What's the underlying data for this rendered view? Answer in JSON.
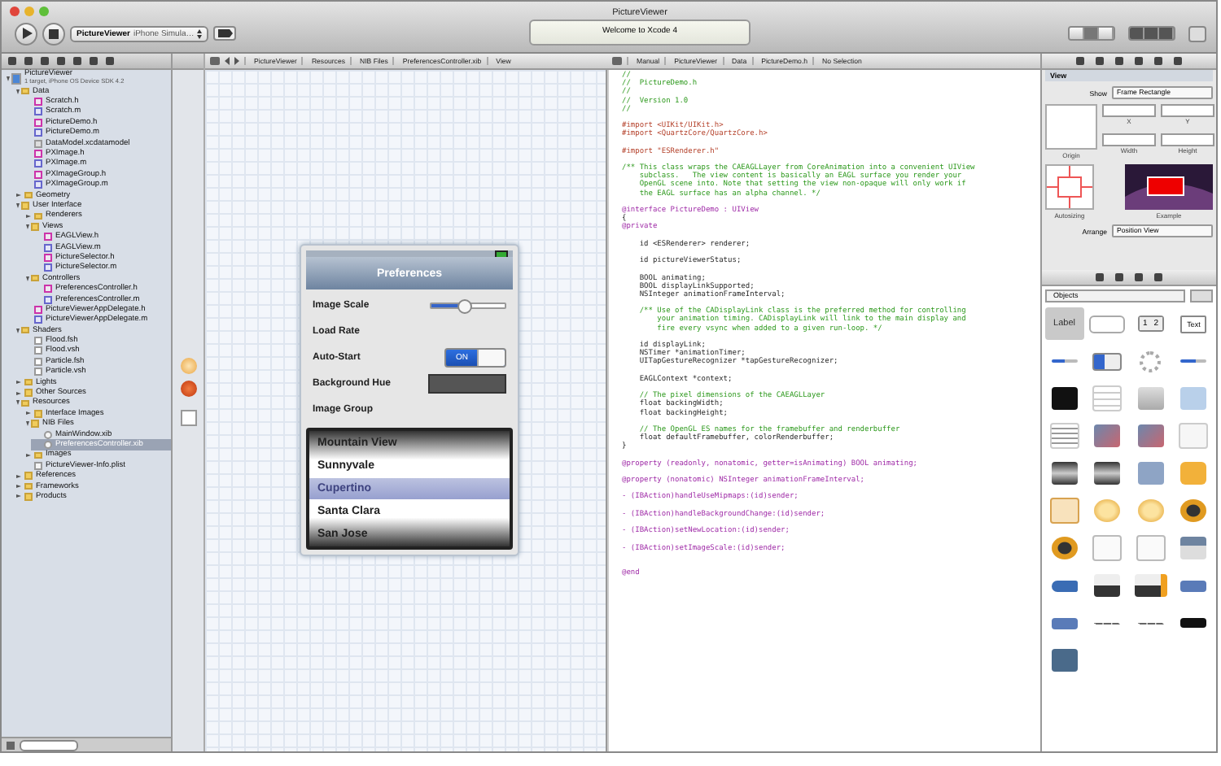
{
  "window": {
    "title": "PictureViewer"
  },
  "toolbar": {
    "scheme": "PictureViewer",
    "destination": "iPhone Simula…",
    "activity": "Welcome to Xcode 4"
  },
  "ib_jump_bar": [
    "PictureViewer",
    "Resources",
    "NIB Files",
    "PreferencesController.xib",
    "View"
  ],
  "editor_jump_bar": [
    "Manual",
    "PictureViewer",
    "Data",
    "PictureDemo.h",
    "No Selection"
  ],
  "navigator": {
    "tree": [
      {
        "name": "PictureViewer",
        "subtitle": "1 target, iPhone OS Device SDK 4.2",
        "kind": "project",
        "expanded": true,
        "selected": false,
        "children": [
          {
            "name": "Data",
            "kind": "folder",
            "expanded": true,
            "selected": false,
            "children": [
              {
                "name": "Scratch.h",
                "kind": "header",
                "selected": false
              },
              {
                "name": "Scratch.m",
                "kind": "source",
                "selected": false
              },
              {
                "name": "PictureDemo.h",
                "kind": "header",
                "selected": false
              },
              {
                "name": "PictureDemo.m",
                "kind": "source",
                "selected": false
              },
              {
                "name": "DataModel.xcdatamodel",
                "kind": "model",
                "selected": false
              },
              {
                "name": "PXImage.h",
                "kind": "header",
                "selected": false
              },
              {
                "name": "PXImage.m",
                "kind": "source",
                "selected": false
              },
              {
                "name": "PXImageGroup.h",
                "kind": "header",
                "selected": false
              },
              {
                "name": "PXImageGroup.m",
                "kind": "source",
                "selected": false
              }
            ]
          },
          {
            "name": "Geometry",
            "kind": "folder",
            "expanded": false,
            "selected": false
          },
          {
            "name": "User Interface",
            "kind": "folder",
            "expanded": true,
            "selected": false,
            "children": [
              {
                "name": "Renderers",
                "kind": "folder",
                "expanded": false,
                "selected": false
              },
              {
                "name": "Views",
                "kind": "folder",
                "expanded": true,
                "selected": false,
                "children": [
                  {
                    "name": "EAGLView.h",
                    "kind": "header",
                    "selected": false
                  },
                  {
                    "name": "EAGLView.m",
                    "kind": "source",
                    "selected": false
                  },
                  {
                    "name": "PictureSelector.h",
                    "kind": "header",
                    "selected": false
                  },
                  {
                    "name": "PictureSelector.m",
                    "kind": "source",
                    "selected": false
                  }
                ]
              },
              {
                "name": "Controllers",
                "kind": "folder",
                "expanded": true,
                "selected": false,
                "children": [
                  {
                    "name": "PreferencesController.h",
                    "kind": "header",
                    "selected": false
                  },
                  {
                    "name": "PreferencesController.m",
                    "kind": "source",
                    "selected": false
                  }
                ]
              },
              {
                "name": "PictureViewerAppDelegate.h",
                "kind": "header",
                "selected": false
              },
              {
                "name": "PictureViewerAppDelegate.m",
                "kind": "source",
                "selected": false
              }
            ]
          },
          {
            "name": "Shaders",
            "kind": "folder",
            "expanded": true,
            "selected": false,
            "children": [
              {
                "name": "Flood.fsh",
                "kind": "shader",
                "selected": false
              },
              {
                "name": "Flood.vsh",
                "kind": "shader",
                "selected": false
              },
              {
                "name": "Particle.fsh",
                "kind": "shader",
                "selected": false
              },
              {
                "name": "Particle.vsh",
                "kind": "shader",
                "selected": false
              }
            ]
          },
          {
            "name": "Lights",
            "kind": "folder",
            "expanded": false,
            "selected": false
          },
          {
            "name": "Other Sources",
            "kind": "folder",
            "expanded": false,
            "selected": false
          },
          {
            "name": "Resources",
            "kind": "folder",
            "expanded": true,
            "selected": false,
            "children": [
              {
                "name": "Interface Images",
                "kind": "folder",
                "expanded": false,
                "selected": false
              },
              {
                "name": "NIB Files",
                "kind": "folder",
                "expanded": true,
                "selected": false,
                "children": [
                  {
                    "name": "MainWindow.xib",
                    "kind": "xib",
                    "selected": false
                  },
                  {
                    "name": "PreferencesController.xib",
                    "kind": "xib",
                    "selected": true
                  }
                ]
              },
              {
                "name": "Images",
                "kind": "images",
                "expanded": false,
                "selected": false
              },
              {
                "name": "PictureViewer-Info.plist",
                "kind": "plist",
                "selected": false
              }
            ]
          },
          {
            "name": "References",
            "kind": "folder",
            "expanded": false,
            "selected": false
          },
          {
            "name": "Frameworks",
            "kind": "folder",
            "expanded": false,
            "selected": false
          },
          {
            "name": "Products",
            "kind": "folder",
            "expanded": false,
            "selected": false
          }
        ]
      }
    ]
  },
  "preferences": {
    "title": "Preferences",
    "rows": [
      {
        "kind": "slider",
        "label": "Image Scale",
        "level": 0.45
      },
      {
        "kind": "plain",
        "label": "Load Rate"
      },
      {
        "kind": "switch",
        "label": "Auto-Start",
        "on": true,
        "switch_text": "ON"
      },
      {
        "kind": "swatch",
        "label": "Background Hue"
      },
      {
        "kind": "plain",
        "label": "Image Group"
      }
    ],
    "picker": [
      {
        "text": "Mountain View",
        "selected": false
      },
      {
        "text": "Sunnyvale",
        "selected": false
      },
      {
        "text": "Cupertino",
        "selected": true
      },
      {
        "text": "Santa Clara",
        "selected": false
      },
      {
        "text": "San Jose",
        "selected": false
      }
    ]
  },
  "code": [
    {
      "kind": "comment",
      "text": "//"
    },
    {
      "kind": "comment",
      "text": "//  PictureDemo.h"
    },
    {
      "kind": "comment",
      "text": "//"
    },
    {
      "kind": "comment",
      "text": "//  Version 1.0"
    },
    {
      "kind": "comment",
      "text": "//"
    },
    {
      "kind": "blank"
    },
    {
      "kind": "directive",
      "text": "#import <UIKit/UIKit.h>"
    },
    {
      "kind": "directive",
      "text": "#import <QuartzCore/QuartzCore.h>"
    },
    {
      "kind": "blank"
    },
    {
      "kind": "directive",
      "text": "#import \"ESRenderer.h\""
    },
    {
      "kind": "blank"
    },
    {
      "kind": "comment",
      "text": "/** This class wraps the CAEAGLLayer from CoreAnimation into a convenient UIView"
    },
    {
      "kind": "comment",
      "text": "    subclass.   The view content is basically an EAGL surface you render your"
    },
    {
      "kind": "comment",
      "text": "    OpenGL scene into. Note that setting the view non-opaque will only work if"
    },
    {
      "kind": "comment",
      "text": "    the EAGL surface has an alpha channel. */"
    },
    {
      "kind": "blank"
    },
    {
      "kind": "keyword",
      "text": "@interface PictureDemo : UIView"
    },
    {
      "kind": "code",
      "text": "{"
    },
    {
      "kind": "keyword",
      "text": "@private"
    },
    {
      "kind": "blank"
    },
    {
      "kind": "code",
      "text": "    id <ESRenderer> renderer;"
    },
    {
      "kind": "blank"
    },
    {
      "kind": "code",
      "text": "    id pictureViewerStatus;"
    },
    {
      "kind": "blank"
    },
    {
      "kind": "code",
      "text": "    BOOL animating;"
    },
    {
      "kind": "code",
      "text": "    BOOL displayLinkSupported;"
    },
    {
      "kind": "code",
      "text": "    NSInteger animationFrameInterval;"
    },
    {
      "kind": "blank"
    },
    {
      "kind": "comment",
      "text": "    /** Use of the CADisplayLink class is the preferred method for controlling"
    },
    {
      "kind": "comment",
      "text": "        your animation timing. CADisplayLink will link to the main display and"
    },
    {
      "kind": "comment",
      "text": "        fire every vsync when added to a given run-loop. */"
    },
    {
      "kind": "blank"
    },
    {
      "kind": "code",
      "text": "    id displayLink;"
    },
    {
      "kind": "code",
      "text": "    NSTimer *animationTimer;"
    },
    {
      "kind": "code",
      "text": "    UITapGestureRecognizer *tapGestureRecognizer;"
    },
    {
      "kind": "blank"
    },
    {
      "kind": "code",
      "text": "    EAGLContext *context;"
    },
    {
      "kind": "blank"
    },
    {
      "kind": "comment",
      "text": "    // The pixel dimensions of the CAEAGLLayer"
    },
    {
      "kind": "code",
      "text": "    float backingWidth;"
    },
    {
      "kind": "code",
      "text": "    float backingHeight;"
    },
    {
      "kind": "blank"
    },
    {
      "kind": "comment",
      "text": "    // The OpenGL ES names for the framebuffer and renderbuffer"
    },
    {
      "kind": "code",
      "text": "    float defaultFramebuffer, colorRenderbuffer;"
    },
    {
      "kind": "code",
      "text": "}"
    },
    {
      "kind": "blank"
    },
    {
      "kind": "keyword",
      "text": "@property (readonly, nonatomic, getter=isAnimating) BOOL animating;"
    },
    {
      "kind": "blank"
    },
    {
      "kind": "keyword",
      "text": "@property (nonatomic) NSInteger animationFrameInterval;"
    },
    {
      "kind": "blank"
    },
    {
      "kind": "keyword",
      "text": "- (IBAction)handleUseMipmaps:(id)sender;"
    },
    {
      "kind": "blank"
    },
    {
      "kind": "keyword",
      "text": "- (IBAction)handleBackgroundChange:(id)sender;"
    },
    {
      "kind": "blank"
    },
    {
      "kind": "keyword",
      "text": "- (IBAction)setNewLocation:(id)sender;"
    },
    {
      "kind": "blank"
    },
    {
      "kind": "keyword",
      "text": "- (IBAction)setImageScale:(id)sender;"
    },
    {
      "kind": "blank"
    },
    {
      "kind": "blank"
    },
    {
      "kind": "keyword",
      "text": "@end"
    }
  ],
  "inspector": {
    "section": "View",
    "show_label": "Show",
    "show_value": "Frame Rectangle",
    "fields": [
      "X",
      "Y",
      "Width",
      "Height"
    ],
    "origin_label": "Origin",
    "autosizing_label": "Autosizing",
    "example_label": "Example",
    "arrange_label": "Arrange",
    "arrange_value": "Position View"
  },
  "library": {
    "popup": "Objects",
    "items": [
      {
        "kind": "label",
        "text": "Label",
        "selected": true
      },
      {
        "kind": "button",
        "selected": false
      },
      {
        "kind": "segmented",
        "segments": [
          "1",
          "2"
        ],
        "selected": false
      },
      {
        "kind": "textfield",
        "text": "Text",
        "selected": false
      },
      {
        "kind": "slider",
        "selected": false
      },
      {
        "kind": "switch",
        "selected": false
      },
      {
        "kind": "activity",
        "selected": false
      },
      {
        "kind": "progress",
        "selected": false
      },
      {
        "kind": "dark",
        "selected": false
      },
      {
        "kind": "table",
        "selected": false
      },
      {
        "kind": "bar",
        "selected": false
      },
      {
        "kind": "map",
        "selected": false
      },
      {
        "kind": "text",
        "selected": false
      },
      {
        "kind": "image",
        "selected": false
      },
      {
        "kind": "image",
        "selected": false
      },
      {
        "kind": "scroll",
        "selected": false
      },
      {
        "kind": "picker",
        "selected": false
      },
      {
        "kind": "picker",
        "selected": false
      },
      {
        "kind": "ad",
        "selected": false
      },
      {
        "kind": "cube",
        "selected": false
      },
      {
        "kind": "cube-outline",
        "selected": false
      },
      {
        "kind": "gold",
        "selected": false
      },
      {
        "kind": "gold",
        "selected": false
      },
      {
        "kind": "gold-dark",
        "selected": false
      },
      {
        "kind": "gold-dark",
        "selected": false
      },
      {
        "kind": "view",
        "selected": false
      },
      {
        "kind": "view",
        "selected": false
      },
      {
        "kind": "navbar",
        "selected": false
      },
      {
        "kind": "back",
        "selected": false
      },
      {
        "kind": "tabbar",
        "selected": false
      },
      {
        "kind": "tabbar-badge",
        "selected": false
      },
      {
        "kind": "toolbar",
        "selected": false
      },
      {
        "kind": "toolbar",
        "selected": false
      },
      {
        "kind": "space",
        "selected": false
      },
      {
        "kind": "space",
        "selected": false
      },
      {
        "kind": "searchbar",
        "selected": false
      },
      {
        "kind": "star",
        "selected": false
      }
    ]
  }
}
